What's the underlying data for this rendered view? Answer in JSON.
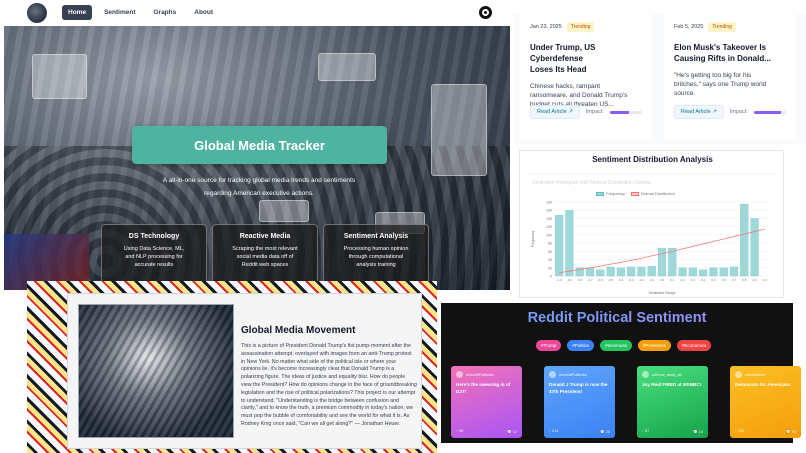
{
  "nav": {
    "items": [
      "Home",
      "Sentiment",
      "Graphs",
      "About"
    ]
  },
  "hero": {
    "title": "Global Media Tracker",
    "subtitle_line1": "A all-in-one source for tracking global media trends and sentiments",
    "subtitle_line2": "regarding American executive actions.",
    "cards": [
      {
        "title": "DS Technology",
        "lines": [
          "Using Data Science, ML,",
          "and NLP processing for",
          "accurate results"
        ]
      },
      {
        "title": "Reactive Media",
        "lines": [
          "Scraping the most relevant",
          "social media data off of",
          "Reddit web spaces"
        ]
      },
      {
        "title": "Sentiment Analysis",
        "lines": [
          "Processing human opinion",
          "through computational",
          "analysis training"
        ]
      }
    ]
  },
  "articles": [
    {
      "date": "Jan 23, 2025",
      "badge": "Trending",
      "title_line1": "Under Trump, US Cyberdefense",
      "title_line2": "Loses Its Head",
      "desc_line1": "Chinese hacks, rampant",
      "desc_line2": "ransomware, and Donald Trump's",
      "desc_line3": "budget cuts all threaten US...",
      "read_label": "Read Article",
      "impact_label": "Impact:",
      "impact": 0.6
    },
    {
      "date": "Feb 5, 2025",
      "badge": "Trending",
      "title_line1": "Elon Musk's Takeover Is",
      "title_line2": "Causing Rifts in Donald...",
      "desc_line1": "\"He's getting too big for his",
      "desc_line2": "britches,\" says one Trump world",
      "desc_line3": "source.",
      "read_label": "Read Article",
      "impact_label": "Impact:",
      "impact": 0.85
    }
  ],
  "sentiment": {
    "title": "Sentiment Distribution Analysis",
    "inner_title": "Sentiment Histogram with Normal Distribution Overlay",
    "legend": [
      "Frequency",
      "Normal Distribution"
    ]
  },
  "chart_data": {
    "type": "bar",
    "categories": [
      "-1.0",
      "-0.9",
      "-0.8",
      "-0.7",
      "-0.6",
      "-0.5",
      "-0.4",
      "-0.3",
      "-0.2",
      "-0.1",
      "0.0",
      "0.1",
      "0.2",
      "0.3",
      "0.4",
      "0.5",
      "0.6",
      "0.7",
      "0.8",
      "0.9",
      "1.0"
    ],
    "series": [
      {
        "name": "Frequency",
        "values": [
          148,
          160,
          20,
          20,
          15,
          22,
          20,
          22,
          22,
          24,
          68,
          68,
          20,
          20,
          15,
          20,
          20,
          22,
          175,
          140,
          0
        ]
      },
      {
        "name": "Normal Distribution",
        "values": [
          8,
          12,
          16,
          20,
          24,
          29,
          33,
          38,
          43,
          49,
          54,
          60,
          66,
          72,
          78,
          84,
          90,
          96,
          102,
          108,
          114
        ]
      }
    ],
    "xlabel": "Sentiment Range",
    "ylabel": "Frequency",
    "ylim": [
      0,
      180
    ],
    "yticks": [
      0,
      20,
      40,
      60,
      80,
      100,
      120,
      140,
      160,
      180
    ],
    "grid": true,
    "legend_position": "top",
    "colors": {
      "bar": "#9fd8d9",
      "line": "#f87171"
    }
  },
  "movement": {
    "title": "Global Media Movement",
    "text": "This is a picture of President Donald Trump's fist pump-moment after the assassination attempt, overlayed with images from an anti-Trump protest in New York. No matter what side of the political isle or where your opinions lie, it's become increasingly clear that Donald Trump is a polarizing figure. The ideas of justice and equality blur. How do people view the President? How do opinions change in the face of groundbreaking legislation and the rise of political polarizations? This project is our attempt to understand. \"Understanding is the bridge between confusion and clarity,\" and to know the truth, a premium commodity in today's nation, we must pop the bubble of comfortability and see the world for what it is. As Rodney King once said, \"Can we all get along?\" — Jonathan Heuer."
  },
  "reddit": {
    "title": "Reddit Political Sentiment",
    "tags": [
      {
        "label": "#Trump",
        "color": "#ec4899"
      },
      {
        "label": "#Politics",
        "color": "#3b82f6"
      },
      {
        "label": "#elonmusk",
        "color": "#22c55e"
      },
      {
        "label": "#Protesters",
        "color": "#f59e0b"
      },
      {
        "label": "#Economics",
        "color": "#ef4444"
      }
    ],
    "posts": [
      {
        "user": "u/redditPolitician",
        "title": "Here's the swearing in of DJT!",
        "up": "56",
        "comments": "12",
        "color1": "#f472b6",
        "color2": "#a855f7"
      },
      {
        "user": "u/redditPolitician",
        "title": "Donald J Trump is now the 47th President!",
        "up": "213",
        "comments": "26",
        "color1": "#60a5fa",
        "color2": "#3b82f6"
      },
      {
        "user": "u/throw_away_alt",
        "title": "Joy Reid FIRED at MSNBC!",
        "up": "87",
        "comments": "15",
        "color1": "#4ade80",
        "color2": "#16a34a"
      },
      {
        "user": "u/redditUser",
        "title": "Democrats for Americans",
        "up": "124",
        "comments": "19",
        "color1": "#fbbf24",
        "color2": "#f59e0b"
      }
    ]
  }
}
